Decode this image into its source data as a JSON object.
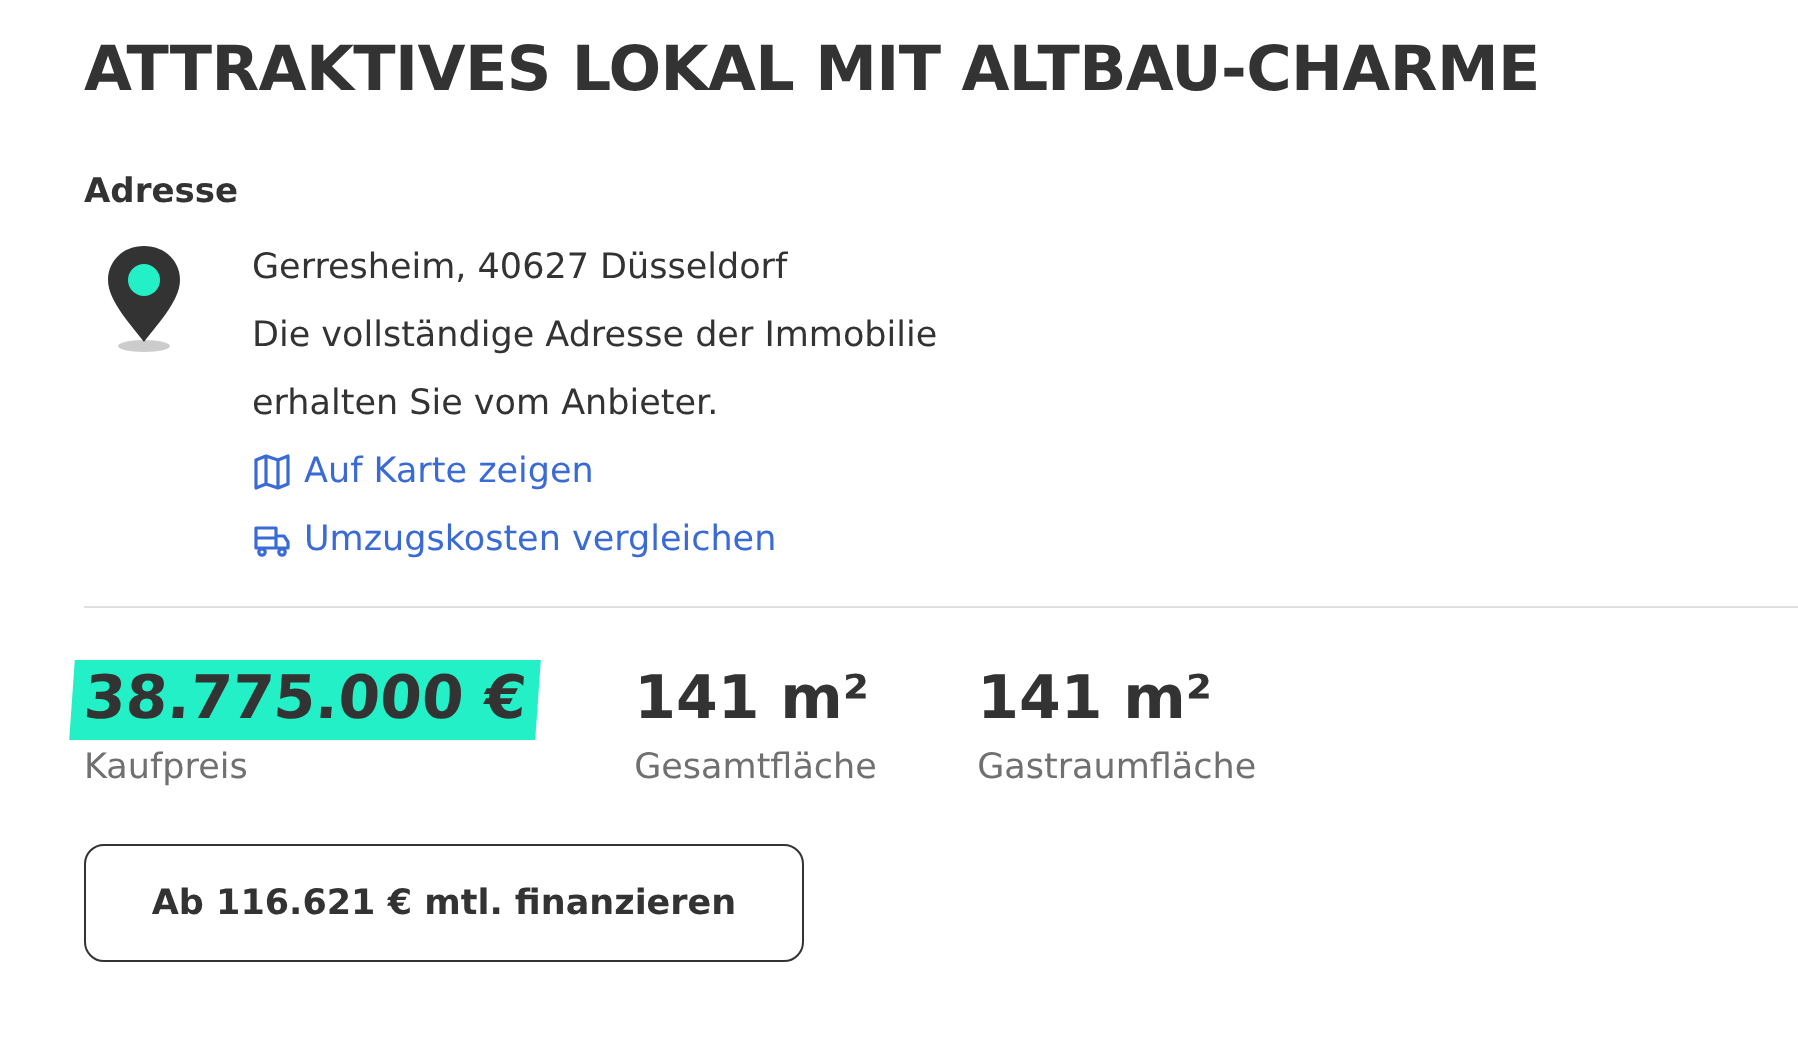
{
  "title": "ATTRAKTIVES LOKAL MIT ALTBAU-CHARME",
  "address": {
    "heading": "Adresse",
    "lines": [
      "Gerresheim, 40627 Düsseldorf",
      "Die vollständige Adresse der Immobilie",
      "erhalten Sie vom Anbieter."
    ],
    "links": [
      {
        "kind": "map",
        "label": "Auf Karte zeigen"
      },
      {
        "kind": "moving",
        "label": "Umzugskosten vergleichen"
      }
    ]
  },
  "key_figures": [
    {
      "value": "38.775.000 €",
      "label": "Kaufpreis",
      "highlighted": true
    },
    {
      "value": "141 m²",
      "label": "Gesamtfläche",
      "highlighted": false
    },
    {
      "value": "141 m²",
      "label": "Gastraumfläche",
      "highlighted": false
    }
  ],
  "finance_button": "Ab 116.621 € mtl. finanzieren"
}
